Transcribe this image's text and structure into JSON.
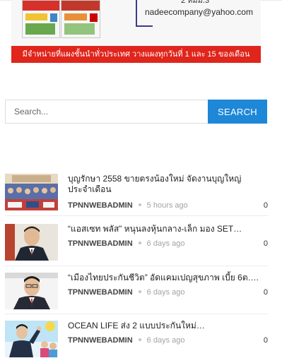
{
  "banner": {
    "email": "nadeecompany@yahoo.com",
    "phone_fragment": "2 หมม.3",
    "ribbon_text": "มีจำหน่ายที่แผงชั้นนำทั่วประเทศ วางแผงทุกวันที่ 1 และ 15 ของเดือน",
    "colors": {
      "ribbon": "#e0251c",
      "bracket": "#3b3b8a"
    }
  },
  "search": {
    "placeholder": "Search...",
    "button_label": "SEARCH",
    "accent": "#1e87d8"
  },
  "posts": [
    {
      "title": "บุญรักษา 2558 ขายตรงน้องใหม่ จัดงานบุญใหญ่ประจำเดือน",
      "author": "TPNNWEBADMIN",
      "time": "5 hours ago",
      "comments": "0"
    },
    {
      "title": "“แอสเซท พลัส” หนุนลงหุ้นกลาง-เล็ก มอง SET…",
      "author": "TPNNWEBADMIN",
      "time": "6 days ago",
      "comments": "0"
    },
    {
      "title": "“เมืองไทยประกันชีวิต” อัดแคมเปญสุขภาพ เบี้ย 6ต….",
      "author": "TPNNWEBADMIN",
      "time": "6 days ago",
      "comments": "0"
    },
    {
      "title": "OCEAN LIFE ส่ง 2 แบบประกันใหม่…",
      "author": "TPNNWEBADMIN",
      "time": "6 days ago",
      "comments": "0"
    }
  ]
}
